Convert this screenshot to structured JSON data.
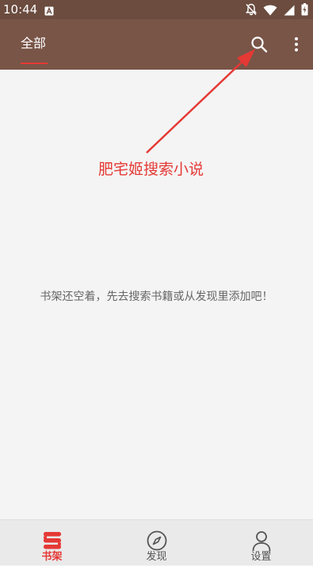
{
  "status_bar": {
    "time": "10:44",
    "notification_icon": "font-download-icon",
    "icons": [
      "notifications-off-icon",
      "wifi-icon",
      "signal-icon",
      "battery-charging-icon"
    ]
  },
  "toolbar": {
    "tab_label": "全部",
    "search_icon": "search-icon",
    "more_icon": "more-vert-icon"
  },
  "annotation": {
    "text": "肥宅姬搜索小说"
  },
  "empty_state": {
    "message": "书架还空着，先去搜索书籍或从发现里添加吧！"
  },
  "bottom_nav": {
    "items": [
      {
        "label": "书架",
        "icon": "bookshelf-icon",
        "active": true
      },
      {
        "label": "发现",
        "icon": "compass-icon",
        "active": false
      },
      {
        "label": "设置",
        "icon": "person-icon",
        "active": false
      }
    ]
  },
  "colors": {
    "status_bar": "#6b4c3f",
    "toolbar": "#795548",
    "accent": "#e53935",
    "background": "#f4f4f4",
    "bottom_nav": "#eaeaea"
  }
}
